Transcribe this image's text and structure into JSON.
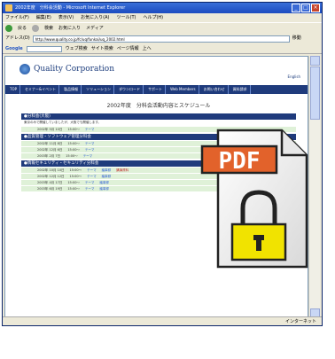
{
  "window": {
    "title": "2002年度　分科会活動 - Microsoft Internet Explorer",
    "status_left": "",
    "status_right": "インターネット"
  },
  "menubar": [
    "ファイル(F)",
    "編集(E)",
    "表示(V)",
    "お気に入り(A)",
    "ツール(T)",
    "ヘルプ(H)"
  ],
  "toolbar": [
    "戻る",
    "検索",
    "お気に入り",
    "メディア"
  ],
  "address": {
    "label": "アドレス(D)",
    "value": "http://www.quality.co.jp/fc/uq/funkai/uq_2002.html",
    "go": "移動"
  },
  "googlebar": {
    "logo": "Google",
    "items": [
      "ウェブ検索",
      "サイト検索",
      "ページ情報",
      "上へ"
    ]
  },
  "site": {
    "logo_text": "Quality Corporation",
    "english": "English",
    "nav": [
      "TOP",
      "セミナー&イベント",
      "製品情報",
      "ソリューション",
      "ダウンロード",
      "サポート",
      "Web Members",
      "お問い合わせ",
      "資料請求"
    ]
  },
  "content": {
    "title": "2002年度　分科会活動内容とスケジュール",
    "sections": [
      {
        "head": "●分科会(大阪)",
        "text": "東京のみで開催していましたが、大阪でも開催します。",
        "rows": [
          {
            "date": "2002年 5月 10日",
            "time": "15:00～",
            "room": "テーマ",
            "sub": "",
            "note": ""
          }
        ]
      },
      {
        "head": "●品質管理・ソフトウェア管理分科会",
        "text": "",
        "rows": [
          {
            "date": "2002年 11月 8日",
            "time": "15:00～",
            "room": "テーマ",
            "sub": "",
            "note": ""
          },
          {
            "date": "2002年 12月 6日",
            "time": "15:00～",
            "room": "テーマ",
            "sub": "",
            "note": ""
          },
          {
            "date": "2003年 2月 7日",
            "time": "15:00～",
            "room": "テーマ",
            "sub": "",
            "note": ""
          }
        ]
      },
      {
        "head": "●情報セキュリティ・セキュリティ分科会",
        "text": "",
        "rows": [
          {
            "date": "2002年 10月 10日",
            "time": "15:00～",
            "room": "テーマ",
            "sub": "議事録",
            "note": "講演資料"
          },
          {
            "date": "2002年 12月 12日",
            "time": "15:00～",
            "room": "テーマ",
            "sub": "議事録",
            "note": ""
          },
          {
            "date": "2003年 4月 17日",
            "time": "15:00～",
            "room": "テーマ",
            "sub": "議事録",
            "note": ""
          },
          {
            "date": "2003年 6月 19日",
            "time": "15:00～",
            "room": "テーマ",
            "sub": "議事録",
            "note": ""
          }
        ]
      }
    ]
  },
  "pdf_overlay": {
    "label": "PDF",
    "icon": "locked-pdf-icon"
  }
}
